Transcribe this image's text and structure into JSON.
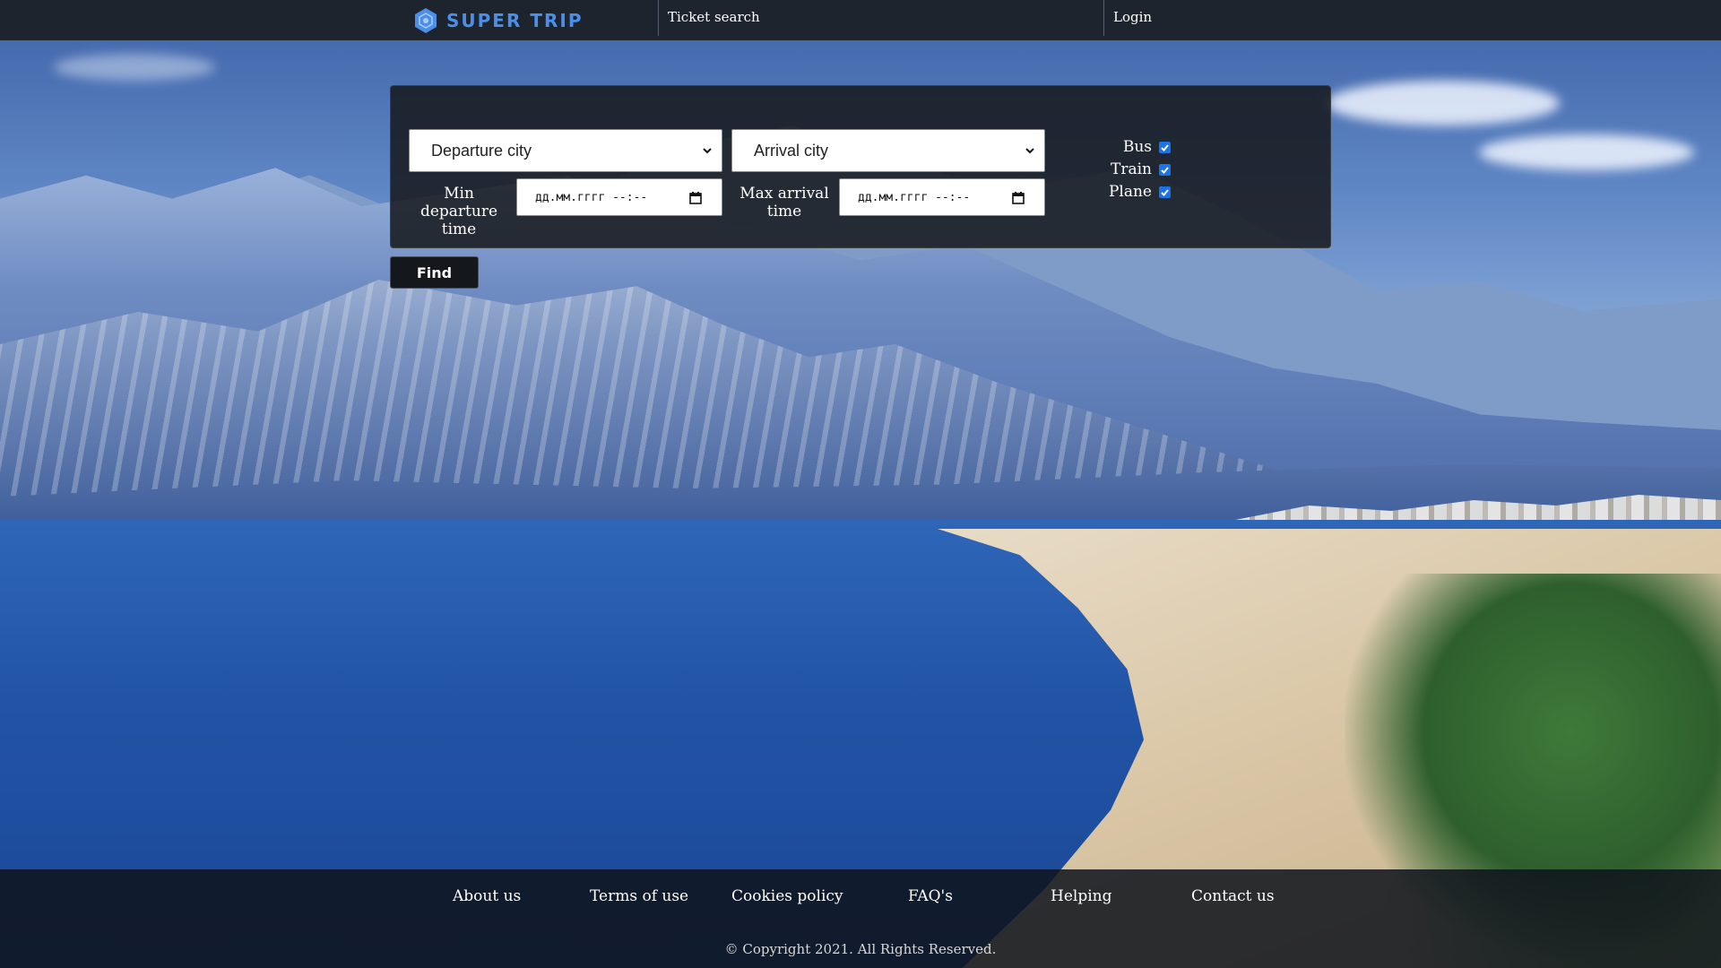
{
  "header": {
    "brand": "SUPER TRIP",
    "nav": {
      "ticket_search": "Ticket search",
      "login": "Login"
    }
  },
  "search": {
    "departure_select": "Departure city",
    "arrival_select": "Arrival city",
    "min_departure_label": "Min departure time",
    "max_arrival_label": "Max arrival time",
    "min_departure_placeholder": "дд.мм.гггг --:--",
    "max_arrival_placeholder": "дд.мм.гггг --:--",
    "transport": [
      {
        "label": "Bus",
        "checked": true
      },
      {
        "label": "Train",
        "checked": true
      },
      {
        "label": "Plane",
        "checked": true
      }
    ],
    "find_button": "Find"
  },
  "footer": {
    "links": [
      "About us",
      "Terms of use",
      "Cookies policy",
      "FAQ's",
      "Helping",
      "Contact us"
    ],
    "copyright": "© Copyright 2021. All Rights Reserved."
  },
  "colors": {
    "brand": "#4b8fe8",
    "header_bg": "#1d242e",
    "checkbox": "#1a73e8"
  }
}
